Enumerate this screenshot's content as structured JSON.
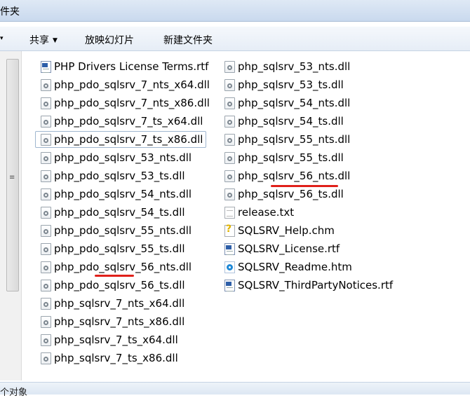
{
  "window": {
    "title": "件夹"
  },
  "toolbar": {
    "share_label": "共享",
    "slideshow_label": "放映幻灯片",
    "new_folder_label": "新建文件夹"
  },
  "status": {
    "text": "个对象"
  },
  "files": {
    "col1": [
      {
        "name": "PHP Drivers License Terms.rtf",
        "type": "rtf"
      },
      {
        "name": "php_pdo_sqlsrv_7_nts_x64.dll",
        "type": "dll"
      },
      {
        "name": "php_pdo_sqlsrv_7_nts_x86.dll",
        "type": "dll"
      },
      {
        "name": "php_pdo_sqlsrv_7_ts_x64.dll",
        "type": "dll"
      },
      {
        "name": "php_pdo_sqlsrv_7_ts_x86.dll",
        "type": "dll",
        "selected": true
      },
      {
        "name": "php_pdo_sqlsrv_53_nts.dll",
        "type": "dll"
      },
      {
        "name": "php_pdo_sqlsrv_53_ts.dll",
        "type": "dll"
      },
      {
        "name": "php_pdo_sqlsrv_54_nts.dll",
        "type": "dll"
      },
      {
        "name": "php_pdo_sqlsrv_54_ts.dll",
        "type": "dll"
      },
      {
        "name": "php_pdo_sqlsrv_55_nts.dll",
        "type": "dll"
      },
      {
        "name": "php_pdo_sqlsrv_55_ts.dll",
        "type": "dll"
      },
      {
        "name": "php_pdo_sqlsrv_56_nts.dll",
        "type": "dll"
      },
      {
        "name": "php_pdo_sqlsrv_56_ts.dll",
        "type": "dll"
      },
      {
        "name": "php_sqlsrv_7_nts_x64.dll",
        "type": "dll"
      },
      {
        "name": "php_sqlsrv_7_nts_x86.dll",
        "type": "dll"
      },
      {
        "name": "php_sqlsrv_7_ts_x64.dll",
        "type": "dll"
      },
      {
        "name": "php_sqlsrv_7_ts_x86.dll",
        "type": "dll"
      }
    ],
    "col2": [
      {
        "name": "php_sqlsrv_53_nts.dll",
        "type": "dll"
      },
      {
        "name": "php_sqlsrv_53_ts.dll",
        "type": "dll"
      },
      {
        "name": "php_sqlsrv_54_nts.dll",
        "type": "dll"
      },
      {
        "name": "php_sqlsrv_54_ts.dll",
        "type": "dll"
      },
      {
        "name": "php_sqlsrv_55_nts.dll",
        "type": "dll"
      },
      {
        "name": "php_sqlsrv_55_ts.dll",
        "type": "dll"
      },
      {
        "name": "php_sqlsrv_56_nts.dll",
        "type": "dll"
      },
      {
        "name": "php_sqlsrv_56_ts.dll",
        "type": "dll"
      },
      {
        "name": "release.txt",
        "type": "txt"
      },
      {
        "name": "SQLSRV_Help.chm",
        "type": "chm"
      },
      {
        "name": "SQLSRV_License.rtf",
        "type": "rtf"
      },
      {
        "name": "SQLSRV_Readme.htm",
        "type": "htm"
      },
      {
        "name": "SQLSRV_ThirdPartyNotices.rtf",
        "type": "rtf"
      }
    ]
  },
  "accent": {
    "annotation": "#e0201a",
    "selection_border": "#9fb6cf"
  }
}
